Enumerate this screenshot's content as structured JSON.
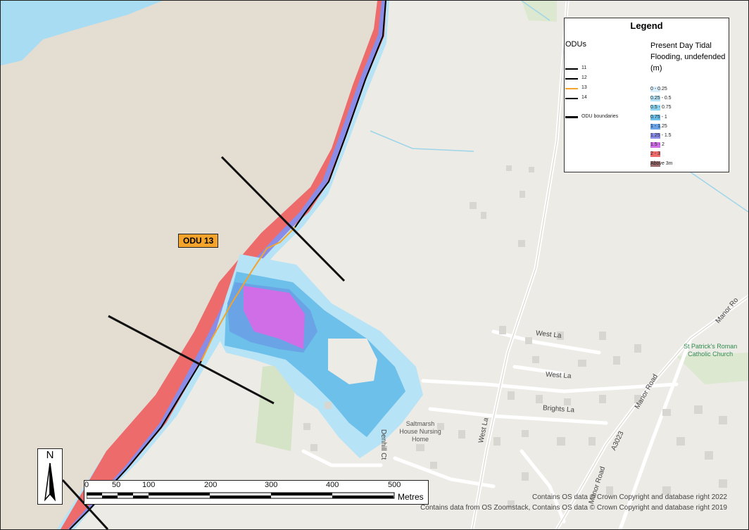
{
  "map": {
    "odu_label": "ODU 13",
    "streets": {
      "west_la_1": "West La",
      "west_la_2": "West La",
      "west_la_vertical": "West La",
      "brights_la": "Brights La",
      "manor_road_1": "Manor Road",
      "manor_road_2": "Manor Road",
      "manor_road_top": "Manor Ro",
      "a3023": "A3023",
      "denhill_ct": "Denhill Ct"
    },
    "poi": {
      "church_line1": "St Patrick's Roman",
      "church_line2": "Catholic Church",
      "nursing_line1": "Saltmarsh",
      "nursing_line2": "House Nursing",
      "nursing_line3": "Home"
    }
  },
  "legend": {
    "title": "Legend",
    "odu_heading": "ODUs",
    "odu_items": [
      {
        "label": "11",
        "color": "#000000"
      },
      {
        "label": "12",
        "color": "#000000"
      },
      {
        "label": "13",
        "color": "#f4a42a"
      },
      {
        "label": "14",
        "color": "#000000"
      }
    ],
    "boundary_label": "ODU boundaries",
    "flood_heading": "Present Day Tidal Flooding, undefended (m)",
    "flood_classes": [
      {
        "label": "0 - 0.25",
        "color": "#d8eef8"
      },
      {
        "label": "0.25 - 0.5",
        "color": "#b6e3f5"
      },
      {
        "label": "0.5 - 0.75",
        "color": "#8cd4f0"
      },
      {
        "label": "0.75 - 1",
        "color": "#6cc0ea"
      },
      {
        "label": "1 - 1.25",
        "color": "#6aa3e6"
      },
      {
        "label": "1.25 - 1.5",
        "color": "#8a8de8"
      },
      {
        "label": "1.5 - 2",
        "color": "#cf6ee6"
      },
      {
        "label": "2 - 3",
        "color": "#ee6b6b"
      },
      {
        "label": "Above 3m",
        "color": "#9b6a6a"
      }
    ]
  },
  "north_arrow": "N",
  "scale_bar": {
    "labels": [
      "0",
      "50",
      "100",
      "200",
      "300",
      "400",
      "500"
    ],
    "unit": "Metres"
  },
  "attribution": {
    "line1": "Contains OS data © Crown Copyright and database right 2022",
    "line2": "Contains data from OS Zoomstack, Contains OS data © Crown Copyright and database right 2019"
  }
}
